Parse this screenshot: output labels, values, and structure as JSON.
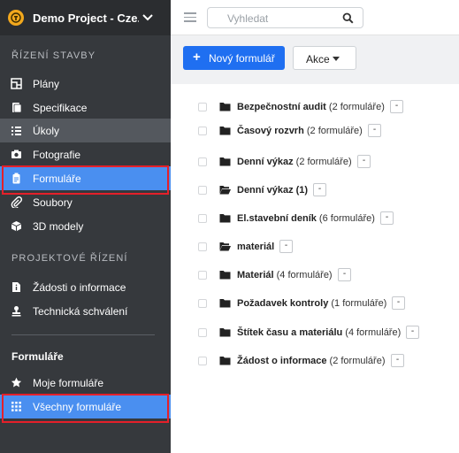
{
  "project": {
    "name": "Demo Project - Cze..."
  },
  "sidebar": {
    "section1_title": "ŘÍZENÍ STAVBY",
    "section1_items": [
      {
        "label": "Plány",
        "icon": "blueprint-icon"
      },
      {
        "label": "Specifikace",
        "icon": "document-icon"
      },
      {
        "label": "Úkoly",
        "icon": "list-icon"
      },
      {
        "label": "Fotografie",
        "icon": "camera-icon"
      },
      {
        "label": "Formuláře",
        "icon": "clipboard-icon"
      },
      {
        "label": "Soubory",
        "icon": "paperclip-icon"
      },
      {
        "label": "3D modely",
        "icon": "cube-icon"
      }
    ],
    "section2_title": "PROJEKTOVÉ ŘÍZENÍ",
    "section2_items": [
      {
        "label": "Žádosti o informace",
        "icon": "info-doc-icon"
      },
      {
        "label": "Technická schválení",
        "icon": "stamp-icon"
      }
    ],
    "forms_heading": "Formuláře",
    "forms_items": [
      {
        "label": "Moje formuláře",
        "icon": "star-icon"
      },
      {
        "label": "Všechny formuláře",
        "icon": "grid-icon"
      }
    ]
  },
  "topbar": {
    "search_placeholder": "Vyhledat"
  },
  "toolbar": {
    "new_form_label": "Nový formulář",
    "actions_label": "Akce",
    "actions_dropdown": "▾"
  },
  "folders": [
    {
      "name": "Bezpečnostní audit",
      "count": " (2 formuláře)",
      "open": false
    },
    {
      "name": "Časový rozvrh",
      "count": " (2 formuláře)",
      "open": false
    },
    {
      "name": "Denní výkaz",
      "count": " (2 formuláře)",
      "open": false
    },
    {
      "name": "Denní výkaz (1)",
      "count": "",
      "open": true
    },
    {
      "name": "El.stavební deník",
      "count": " (6 formuláře)",
      "open": false
    },
    {
      "name": "materiál",
      "count": "",
      "open": true
    },
    {
      "name": "Materiál",
      "count": " (4 formuláře)",
      "open": false
    },
    {
      "name": "Požadavek kontroly",
      "count": " (1 formuláře)",
      "open": false
    },
    {
      "name": "Štítek času a materiálu",
      "count": " (4 formuláře)",
      "open": false
    },
    {
      "name": "Žádost o informace",
      "count": " (2 formuláře)",
      "open": false
    }
  ],
  "row_menu_label": "-",
  "colors": {
    "sidebar_bg": "#36393d",
    "selected": "#4a8ff0",
    "primary_button": "#1f6ff1",
    "highlight_outline": "#e5202a"
  }
}
